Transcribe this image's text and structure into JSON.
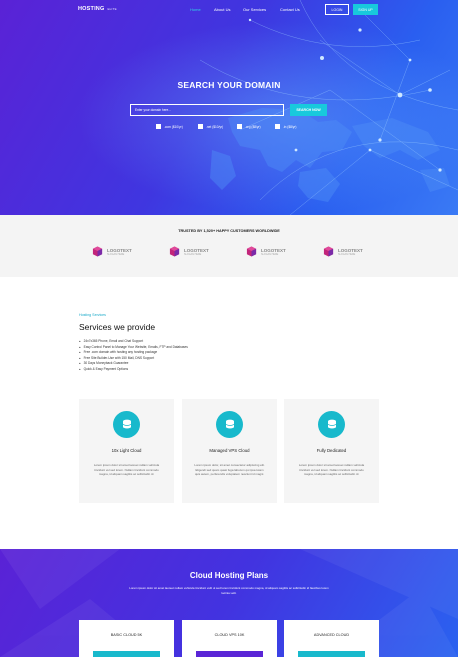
{
  "nav": {
    "logo": "HOSTING",
    "logo_sub": "ELITE",
    "links": [
      "Home",
      "About Us",
      "Our Services",
      "Contact Us"
    ],
    "login": "LOGIN",
    "signup": "SIGN UP"
  },
  "hero": {
    "title": "SEARCH YOUR DOMAIN",
    "search_placeholder": "Enter your domain here...",
    "search_button": "SEARCH NOW",
    "tlds": [
      ".com ($10/yr)",
      ".net ($10/yr)",
      ".org ($8/yr)",
      ".in ($8/yr)"
    ]
  },
  "trusted": {
    "title": "TRUSTED BY 1,520+ HAPPY CUSTOMERS WORLDWIDE",
    "logo_name": "LOGOTEXT",
    "logo_tag": "SLOGAN HERE"
  },
  "services": {
    "eyebrow": "Hosting Services",
    "title": "Services we provide",
    "list": [
      "24x7x365 Phone, Email and Chat Support",
      "Easy Control Panel to Manage Your Website, Emails, FTP and Databases",
      "Free .com domain with hosting any hosting package",
      "Free Site Builder-Use with 150 Mail, DNS Support",
      "30 Days Moneyback Guarantee",
      "Quick & Easy Payment Options"
    ],
    "cards": [
      {
        "title": "10x Light Cloud",
        "desc": "Lorem ipsum dolor sit amet laoreet nullam vehicula tincidunt vel sed lorem. Nullam tincidunt commodo magna, id aliquam sagittis ac sollicitudin id."
      },
      {
        "title": "Managed VPS Cloud",
        "desc": "Lorem ipsum dolor, sit amet consectetur adipiscing elit. Eligendi sed quam quasi fuga laborum qui ipsa totam quis autem, perferendis voluptatem nesciunt id magni."
      },
      {
        "title": "Fully Dedicated",
        "desc": "Lorem ipsum dolor sit amet laoreet nullam vehicula tincidunt vel sed lorem. Nullam tincidunt commodo magna, id aliquam sagittis ac sollicitudin id."
      }
    ]
  },
  "cloud": {
    "title": "Cloud Hosting Plans",
    "desc": "Lorem ipsum dolor sit amet laoreet nullam vehicula tincidunt velit ut sed lorem tincidunt commodo magna, id aliquam sagittis ac sollicitudin id faucibus lorem lacinia velit.",
    "plans": [
      "BASIC CLOUD 5K",
      "CLOUD VPS 10K",
      "ADVANCED CLOUD"
    ]
  },
  "colors": {
    "accent": "#18c9dc",
    "hero_start": "#5a22d6",
    "hero_end": "#3a7af5",
    "plan_bar_mid": "#5a25d6"
  }
}
